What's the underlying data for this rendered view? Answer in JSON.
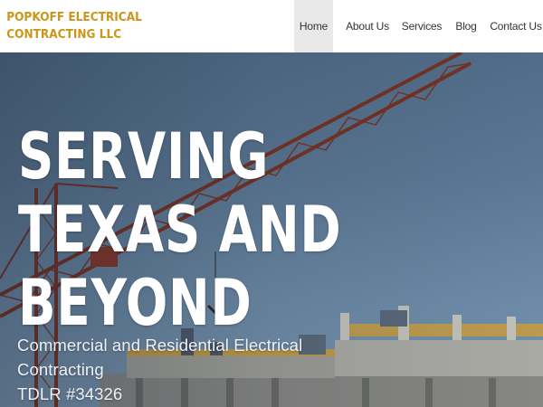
{
  "brand": {
    "line1": "POPKOFF ELECTRICAL",
    "line2": "CONTRACTING LLC",
    "color": "#c9961a"
  },
  "nav": {
    "items": [
      {
        "label": "Home",
        "active": true
      },
      {
        "label": "About Us",
        "active": false
      },
      {
        "label": "Services",
        "active": false
      },
      {
        "label": "Blog",
        "active": false
      },
      {
        "label": "Contact Us",
        "active": false
      }
    ]
  },
  "hero": {
    "title_lines": [
      "SERVING",
      "TEXAS AND",
      "BEYOND"
    ],
    "subtitle_lines": [
      "Commercial and Residential Electrical",
      "Contracting",
      "TDLR #34326"
    ],
    "background_image": "tower-crane-over-building-under-construction"
  }
}
